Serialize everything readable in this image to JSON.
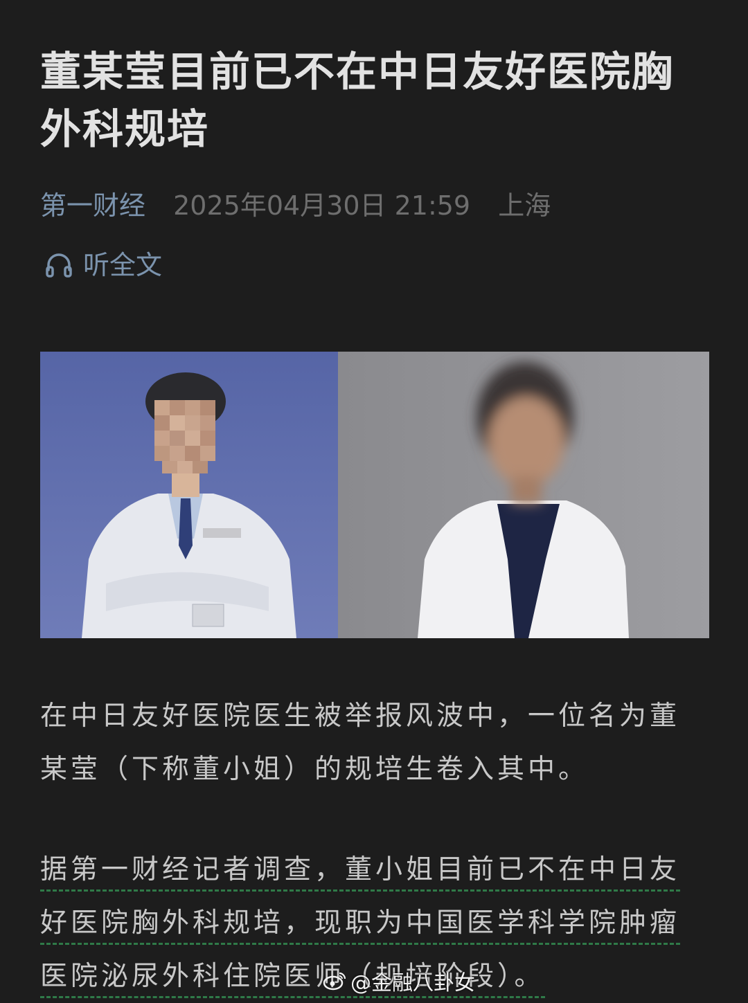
{
  "article": {
    "title": "董某莹目前已不在中日友好医院胸外科规培",
    "source": "第一财经",
    "datetime": "2025年04月30日 21:59",
    "location": "上海",
    "listen_label": "听全文"
  },
  "photo": {
    "left_person": "male doctor in white coat, face pixelated, blue background",
    "right_person": "female doctor in white coat, face blurred, grey background"
  },
  "paragraphs": {
    "p1": "在中日友好医院医生被举报风波中，一位名为董某莹（下称董小姐）的规培生卷入其中。",
    "p2": "据第一财经记者调查，董小姐目前已不在中日友好医院胸外科规培，现职为中国医学科学院肿瘤医院泌尿外科住院医师（规培阶段）。"
  },
  "watermark": {
    "text": "@金融八卦女",
    "icon": "weibo-icon"
  },
  "colors": {
    "background": "#1d1d1d",
    "title": "#e2e2e2",
    "accent": "#7b93ad",
    "muted": "#6e6e6e",
    "highlight_underline": "#2f7a48"
  }
}
